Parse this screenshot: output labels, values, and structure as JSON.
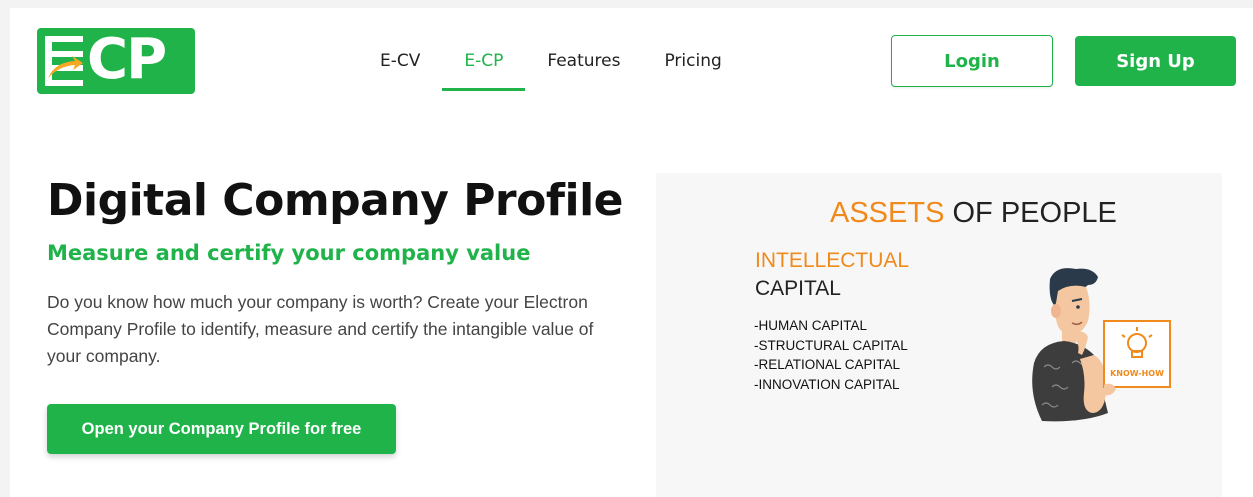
{
  "header": {
    "logo_text": "CP",
    "nav": [
      {
        "label": "E-CV",
        "active": false
      },
      {
        "label": "E-CP",
        "active": true
      },
      {
        "label": "Features",
        "active": false
      },
      {
        "label": "Pricing",
        "active": false
      }
    ],
    "login_label": "Login",
    "signup_label": "Sign Up"
  },
  "hero": {
    "title": "Digital Company Profile",
    "subtitle": "Measure and certify your company value",
    "description": "Do you know how much your company is worth? Create your Electron Company Profile to identify, measure and certify the intangible value of your company.",
    "cta_label": "Open your Company Profile for free"
  },
  "illustration": {
    "title_accent": "ASSETS",
    "title_rest": " OF PEOPLE",
    "heading_1": "INTELLECTUAL",
    "heading_2": "CAPITAL",
    "items": [
      "-HUMAN CAPITAL",
      "-STRUCTURAL CAPITAL",
      "-RELATIONAL CAPITAL",
      "-INNOVATION CAPITAL"
    ],
    "sign_label": "KNOW-HOW"
  },
  "colors": {
    "brand": "#1fb34a",
    "accent": "#f08a1c",
    "text": "#111111"
  },
  "icons": [
    "logo-e-arrow-icon",
    "lightbulb-icon"
  ]
}
